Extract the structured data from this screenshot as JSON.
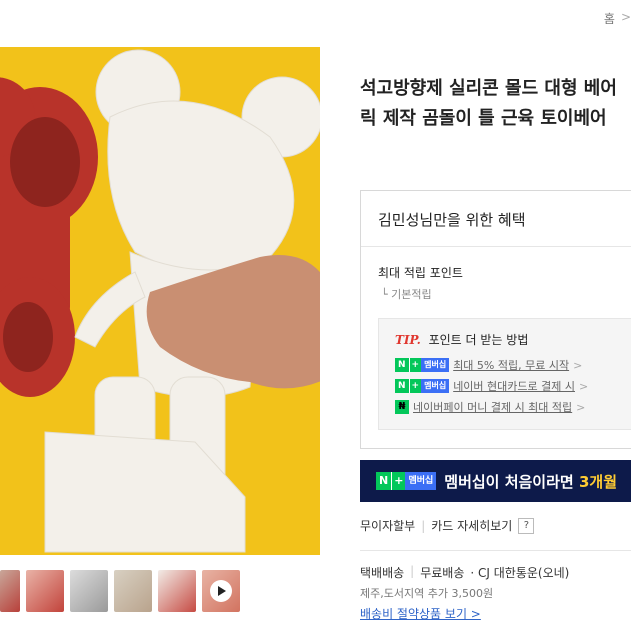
{
  "breadcrumb": {
    "home": "홈",
    "sep": ">"
  },
  "product": {
    "title_line1": "석고방향제 실리콘 몰드 대형 베어",
    "title_line2": "릭 제작 곰돌이 틀 근육 토이베어"
  },
  "benefit": {
    "title": "김민성님만을 위한 혜택",
    "max_point_label": "최대 적립 포인트",
    "basic_point_label": "└ 기본적립",
    "tip": {
      "tag": "TIP.",
      "heading": "포인트 더 받는 방법",
      "rows": [
        {
          "badge": "N+ 멤버십",
          "text": "최대 5% 적립, 무료 시작",
          "chevron": ">"
        },
        {
          "badge": "N+ 멤버십",
          "text": "네이버 현대카드로 결제 시",
          "chevron": ">"
        },
        {
          "badge": "N pay",
          "text": "네이버페이 머니 결제 시 최대 적립",
          "chevron": ">"
        }
      ]
    }
  },
  "badge": {
    "n": "N",
    "plus": "+",
    "mem": "멤버십",
    "pay": "₦"
  },
  "banner": {
    "text": "멤버십이 처음이라면",
    "highlight": "3개월"
  },
  "installment": {
    "label": "무이자할부",
    "sep": "|",
    "card_link": "카드 자세히보기",
    "help": "?"
  },
  "shipping": {
    "type": "택배배송",
    "sep": "|",
    "fee": "무료배송",
    "courier": "· CJ 대한통운(오네)",
    "extra": "제주,도서지역 추가 3,500원",
    "link": "배송비 절약상품 보기 >"
  },
  "colors": {
    "image_bg": "#f2c21a",
    "banner_bg": "#0d1a4a",
    "accent_green": "#03c75a",
    "tip_red": "#e0372f"
  },
  "icons": [
    "play-icon",
    "help-icon",
    "chevron-right-icon"
  ]
}
